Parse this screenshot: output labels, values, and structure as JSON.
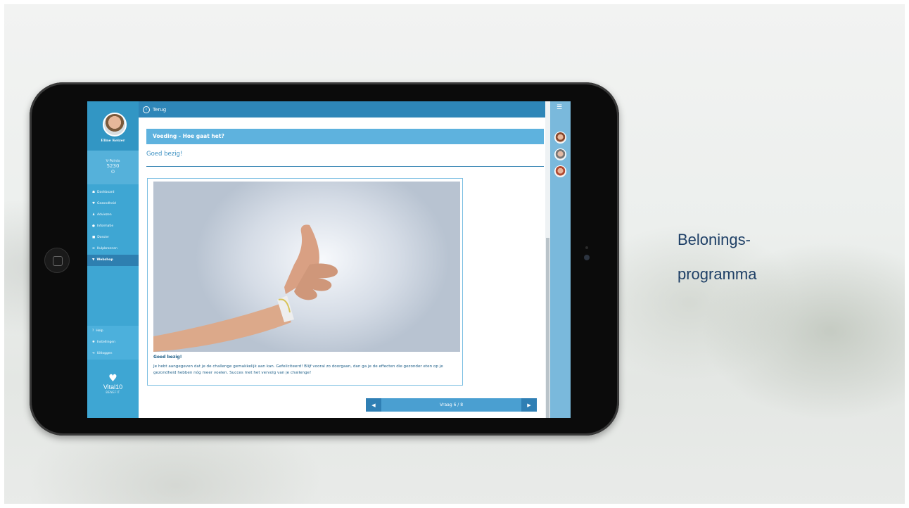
{
  "slide": {
    "title_line1": "Belonings-",
    "title_line2": "programma"
  },
  "app": {
    "topbar": {
      "back_label": "Terug",
      "back_icon": "back-arrow-icon"
    },
    "profile": {
      "name": "Eline Keizer"
    },
    "points": {
      "label": "V-Points",
      "value": "5230",
      "icon": "⊙"
    },
    "nav": [
      {
        "label": "Dashboard",
        "icon": "home-icon",
        "glyph": "☗"
      },
      {
        "label": "Gezondheid",
        "icon": "heart-icon",
        "glyph": "♥"
      },
      {
        "label": "Adviezen",
        "icon": "person-icon",
        "glyph": "♟"
      },
      {
        "label": "Informatie",
        "icon": "info-icon",
        "glyph": "●"
      },
      {
        "label": "Dossier",
        "icon": "folder-icon",
        "glyph": "■"
      },
      {
        "label": "Hulpbronnen",
        "icon": "link-icon",
        "glyph": "⊘"
      },
      {
        "label": "Webshop",
        "icon": "cart-icon",
        "glyph": "▼",
        "active": true
      }
    ],
    "nav_bottom": [
      {
        "label": "Help",
        "icon": "help-icon",
        "glyph": "?"
      },
      {
        "label": "Instellingen",
        "icon": "gear-icon",
        "glyph": "✺"
      },
      {
        "label": "Uitloggen",
        "icon": "logout-icon",
        "glyph": "➜"
      }
    ],
    "logo": {
      "text": "Vital10",
      "sub": "BENEFIT"
    },
    "content": {
      "section_title": "Voeding - Hoe gaat het?",
      "subtitle": "Goed bezig!",
      "card_title": "Goed bezig!",
      "card_text": "Je hebt aangegeven dat je de challenge gemakkelijk aan kan. Gefeliciteerd! Blijf vooral zo doorgaan, dan ga je de effecten die gezonder eten op je gezondheid hebben nóg meer voelen. Succes met het vervolg van je challenge!",
      "image_alt": "thumbs-up photo"
    },
    "pager": {
      "label": "Vraag 6 / 8"
    },
    "rightbar": {
      "menu_icon": "hamburger-menu-icon"
    },
    "colors": {
      "sidebar": "#3ea6d3",
      "topbar": "#2e86b8",
      "section_header": "#5eb2de",
      "accent_text": "#1e5f88"
    }
  }
}
